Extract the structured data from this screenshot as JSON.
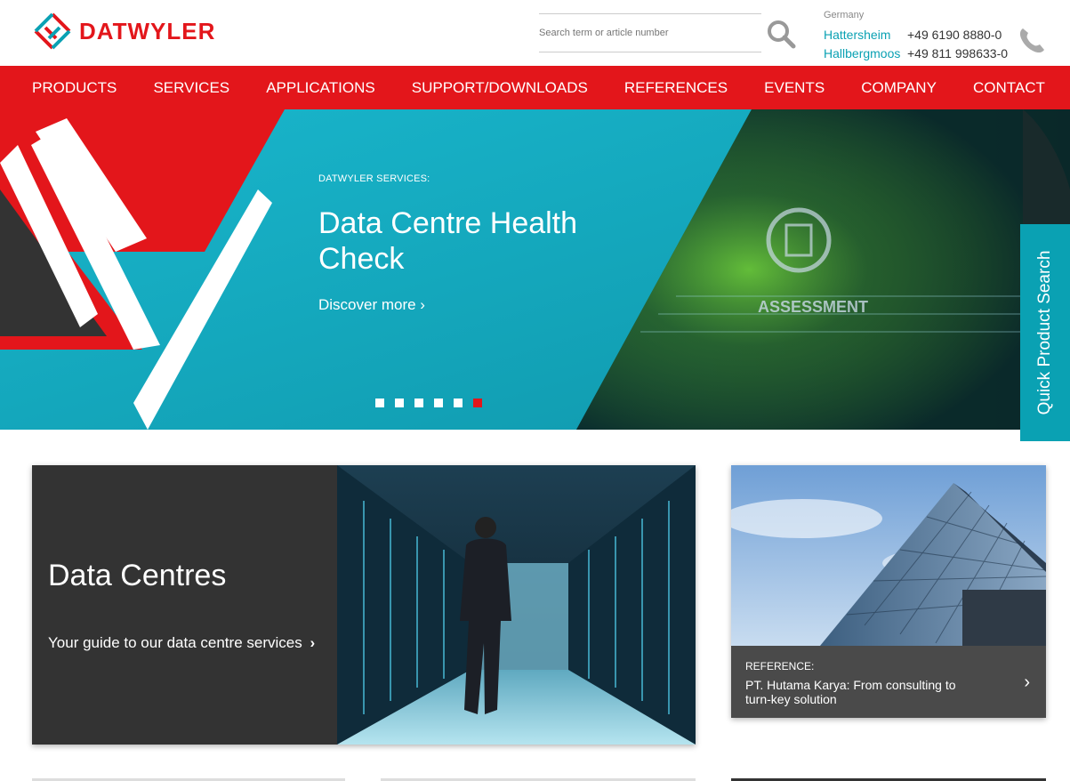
{
  "brand": {
    "name": "DATWYLER",
    "color": "#e3161b",
    "accent": "#0aa1b3"
  },
  "search": {
    "placeholder": "Search term or article number",
    "icon": "search-icon"
  },
  "contact": {
    "country": "Germany",
    "locations": [
      {
        "city": "Hattersheim",
        "phone": "+49 6190 8880-0"
      },
      {
        "city": "Hallbergmoos",
        "phone": "+49 811 998633-0"
      }
    ],
    "icon": "phone-icon"
  },
  "nav": {
    "items": [
      "PRODUCTS",
      "SERVICES",
      "APPLICATIONS",
      "SUPPORT/DOWNLOADS",
      "REFERENCES",
      "EVENTS",
      "COMPANY",
      "CONTACT"
    ]
  },
  "hero": {
    "eyebrow": "DATWYLER SERVICES:",
    "title": "Data Centre Health Check",
    "link": "Discover more ›",
    "image_text": "ASSESSMENT",
    "slides": 6,
    "active_slide": 6
  },
  "quick_search": {
    "label": "Quick Product Search"
  },
  "card_datacentres": {
    "title": "Data Centres",
    "link": "Your guide to our data centre services"
  },
  "card_reference": {
    "eyebrow": "REFERENCE:",
    "title": "PT. Hutama Karya: From consulting to turn-key solution"
  }
}
